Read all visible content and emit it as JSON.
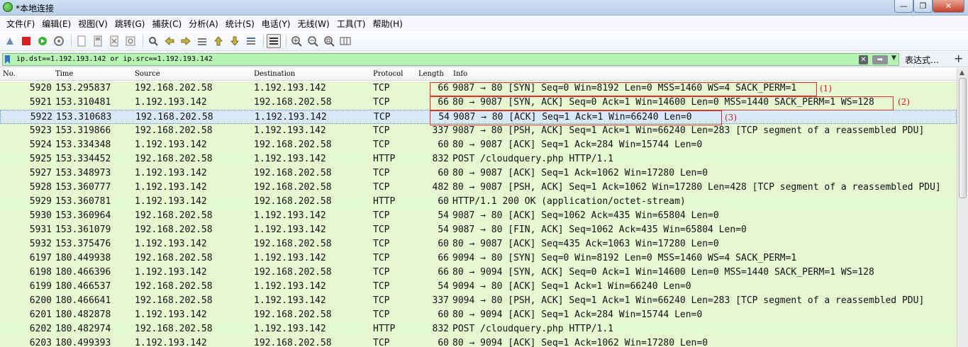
{
  "window": {
    "title": "*本地连接",
    "controls": {
      "minimize": "—",
      "maximize": "❐",
      "close": "✕"
    }
  },
  "menu": [
    "文件(F)",
    "编辑(E)",
    "视图(V)",
    "跳转(G)",
    "捕获(C)",
    "分析(A)",
    "统计(S)",
    "电话(Y)",
    "无线(W)",
    "工具(T)",
    "帮助(H)"
  ],
  "toolbar": {
    "icons": [
      "shark-fin-icon",
      "stop-icon",
      "restart-icon",
      "options-gear-icon",
      "open-file-icon",
      "save-file-icon",
      "close-file-icon",
      "reload-icon",
      "find-icon",
      "back-icon",
      "forward-icon",
      "goto-icon",
      "first-icon",
      "last-icon",
      "autoscroll-icon",
      "colorize-icon",
      "zoom-in-icon",
      "zoom-out-icon",
      "zoom-normal-icon",
      "resize-columns-icon"
    ]
  },
  "filter": {
    "value": "ip.dst==1.192.193.142 or ip.src==1.192.193.142",
    "expression_label": "表达式…",
    "add_label": "+",
    "color": "#b7f3b3"
  },
  "columns": {
    "no": "No.",
    "time": "Time",
    "source": "Source",
    "destination": "Destination",
    "protocol": "Protocol",
    "length": "Length",
    "info": "Info"
  },
  "packets": [
    {
      "no": "5920",
      "time": "153.295837",
      "src": "192.168.202.58",
      "dst": "1.192.193.142",
      "proto": "TCP",
      "len": "66",
      "info": "9087 → 80 [SYN] Seq=0 Win=8192 Len=0 MSS=1460 WS=4 SACK_PERM=1"
    },
    {
      "no": "5921",
      "time": "153.310481",
      "src": "1.192.193.142",
      "dst": "192.168.202.58",
      "proto": "TCP",
      "len": "66",
      "info": "80 → 9087 [SYN, ACK] Seq=0 Ack=1 Win=14600 Len=0 MSS=1440 SACK_PERM=1 WS=128"
    },
    {
      "no": "5922",
      "time": "153.310683",
      "src": "192.168.202.58",
      "dst": "1.192.193.142",
      "proto": "TCP",
      "len": "54",
      "info": "9087 → 80 [ACK] Seq=1 Ack=1 Win=66240 Len=0"
    },
    {
      "no": "5923",
      "time": "153.319866",
      "src": "192.168.202.58",
      "dst": "1.192.193.142",
      "proto": "TCP",
      "len": "337",
      "info": "9087 → 80 [PSH, ACK] Seq=1 Ack=1 Win=66240 Len=283 [TCP segment of a reassembled PDU]"
    },
    {
      "no": "5924",
      "time": "153.334348",
      "src": "1.192.193.142",
      "dst": "192.168.202.58",
      "proto": "TCP",
      "len": "60",
      "info": "80 → 9087 [ACK] Seq=1 Ack=284 Win=15744 Len=0"
    },
    {
      "no": "5925",
      "time": "153.334452",
      "src": "192.168.202.58",
      "dst": "1.192.193.142",
      "proto": "HTTP",
      "len": "832",
      "info": "POST /cloudquery.php HTTP/1.1"
    },
    {
      "no": "5927",
      "time": "153.348973",
      "src": "1.192.193.142",
      "dst": "192.168.202.58",
      "proto": "TCP",
      "len": "60",
      "info": "80 → 9087 [ACK] Seq=1 Ack=1062 Win=17280 Len=0"
    },
    {
      "no": "5928",
      "time": "153.360777",
      "src": "1.192.193.142",
      "dst": "192.168.202.58",
      "proto": "TCP",
      "len": "482",
      "info": "80 → 9087 [PSH, ACK] Seq=1 Ack=1062 Win=17280 Len=428 [TCP segment of a reassembled PDU]"
    },
    {
      "no": "5929",
      "time": "153.360781",
      "src": "1.192.193.142",
      "dst": "192.168.202.58",
      "proto": "HTTP",
      "len": "60",
      "info": "HTTP/1.1 200 OK  (application/octet-stream)"
    },
    {
      "no": "5930",
      "time": "153.360964",
      "src": "192.168.202.58",
      "dst": "1.192.193.142",
      "proto": "TCP",
      "len": "54",
      "info": "9087 → 80 [ACK] Seq=1062 Ack=435 Win=65804 Len=0"
    },
    {
      "no": "5931",
      "time": "153.361079",
      "src": "192.168.202.58",
      "dst": "1.192.193.142",
      "proto": "TCP",
      "len": "54",
      "info": "9087 → 80 [FIN, ACK] Seq=1062 Ack=435 Win=65804 Len=0"
    },
    {
      "no": "5932",
      "time": "153.375476",
      "src": "1.192.193.142",
      "dst": "192.168.202.58",
      "proto": "TCP",
      "len": "60",
      "info": "80 → 9087 [ACK] Seq=435 Ack=1063 Win=17280 Len=0"
    },
    {
      "no": "6197",
      "time": "180.449938",
      "src": "192.168.202.58",
      "dst": "1.192.193.142",
      "proto": "TCP",
      "len": "66",
      "info": "9094 → 80 [SYN] Seq=0 Win=8192 Len=0 MSS=1460 WS=4 SACK_PERM=1"
    },
    {
      "no": "6198",
      "time": "180.466396",
      "src": "1.192.193.142",
      "dst": "192.168.202.58",
      "proto": "TCP",
      "len": "66",
      "info": "80 → 9094 [SYN, ACK] Seq=0 Ack=1 Win=14600 Len=0 MSS=1440 SACK_PERM=1 WS=128"
    },
    {
      "no": "6199",
      "time": "180.466537",
      "src": "192.168.202.58",
      "dst": "1.192.193.142",
      "proto": "TCP",
      "len": "54",
      "info": "9094 → 80 [ACK] Seq=1 Ack=1 Win=66240 Len=0"
    },
    {
      "no": "6200",
      "time": "180.466641",
      "src": "192.168.202.58",
      "dst": "1.192.193.142",
      "proto": "TCP",
      "len": "337",
      "info": "9094 → 80 [PSH, ACK] Seq=1 Ack=1 Win=66240 Len=283 [TCP segment of a reassembled PDU]"
    },
    {
      "no": "6201",
      "time": "180.482878",
      "src": "1.192.193.142",
      "dst": "192.168.202.58",
      "proto": "TCP",
      "len": "60",
      "info": "80 → 9094 [ACK] Seq=1 Ack=284 Win=15744 Len=0"
    },
    {
      "no": "6202",
      "time": "180.482974",
      "src": "192.168.202.58",
      "dst": "1.192.193.142",
      "proto": "HTTP",
      "len": "832",
      "info": "POST /cloudquery.php HTTP/1.1"
    },
    {
      "no": "6203",
      "time": "180.499393",
      "src": "1.192.193.142",
      "dst": "192.168.202.58",
      "proto": "TCP",
      "len": "60",
      "info": "80 → 9094 [ACK] Seq=1 Ack=1062 Win=17280 Len=0"
    }
  ],
  "selected_packet": "5922",
  "annotations": [
    "(1)",
    "(2)",
    "(3)"
  ],
  "colors": {
    "tcp_row": "#e7f7d2",
    "http_row": "#e4f9cf",
    "selected_row": "#d9e9f7",
    "annotation": "#e03030"
  }
}
